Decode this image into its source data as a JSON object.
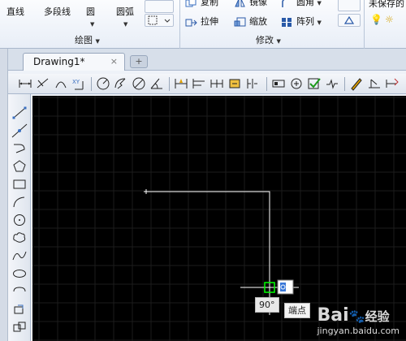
{
  "ribbon": {
    "draw_panel": {
      "items": [
        {
          "label": "直线"
        },
        {
          "label": "多段线"
        },
        {
          "label": "圆"
        },
        {
          "label": "圆弧"
        }
      ],
      "panel_label": "绘图"
    },
    "modify_panel": {
      "items": [
        {
          "label": "复制"
        },
        {
          "label": "镜像"
        },
        {
          "label": "圆角"
        },
        {
          "label": "拉伸"
        },
        {
          "label": "缩放"
        },
        {
          "label": "阵列"
        }
      ],
      "panel_label": "修改"
    },
    "layers_panel": {
      "label": "未保存的"
    }
  },
  "tabs": [
    {
      "label": "Drawing1*",
      "close": "×"
    }
  ],
  "canvas": {
    "background": "#000000",
    "grid_color": "#1c1c1c",
    "line_color": "#ffffff",
    "snap_color": "#00ff00",
    "angle_tooltip": "90°",
    "snap_tooltip": "端点"
  },
  "watermark": {
    "brand": "Bai",
    "brand2": "经验",
    "url": "jingyan.baidu.com"
  }
}
